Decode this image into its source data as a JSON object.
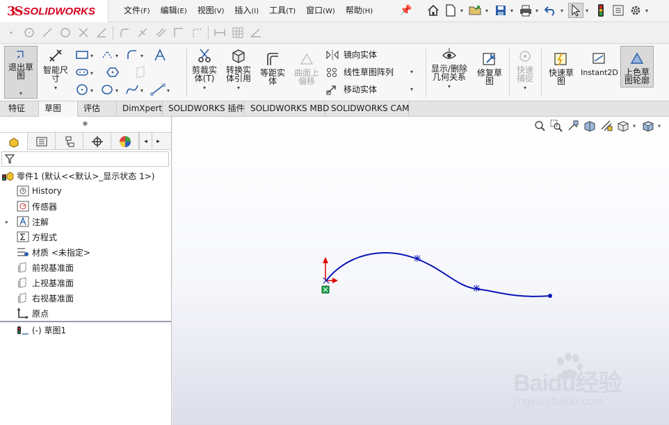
{
  "app": {
    "logo_mark": "3S",
    "logo_text": "SOLIDWORKS"
  },
  "menu": [
    {
      "label": "文件",
      "key": "(F)"
    },
    {
      "label": "编辑",
      "key": "(E)"
    },
    {
      "label": "视图",
      "key": "(V)"
    },
    {
      "label": "插入",
      "key": "(I)"
    },
    {
      "label": "工具",
      "key": "(T)"
    },
    {
      "label": "窗口",
      "key": "(W)"
    },
    {
      "label": "帮助",
      "key": "(H)"
    }
  ],
  "ribbon": {
    "exit_sketch": "退出草图",
    "smart_dimension": "智能尺寸",
    "trim": "剪裁实体(T)",
    "convert": "转换实体引用",
    "offset": "等距实体",
    "surface_offset": "曲面上偏移",
    "mirror": "镜向实体",
    "linear_pattern": "线性草图阵列",
    "move": "移动实体",
    "display_delete": "显示/删除几何关系",
    "repair": "修复草图",
    "quick_snap": "快速捕捉",
    "rapid_sketch": "快速草图",
    "instant2d": "Instant2D",
    "shaded_contour": "上色草图轮廓"
  },
  "tabs": [
    "特征",
    "草图",
    "评估",
    "DimXpert",
    "SOLIDWORKS 插件",
    "SOLIDWORKS MBD",
    "SOLIDWORKS CAM"
  ],
  "active_tab": "草图",
  "tree": {
    "root": "零件1 (默认<<默认>_显示状态 1>)",
    "items": [
      "History",
      "传感器",
      "注解",
      "方程式",
      "材质 <未指定>",
      "前视基准面",
      "上视基准面",
      "右视基准面",
      "原点",
      "(-) 草图1"
    ]
  },
  "watermark": {
    "main": "Baidu经验",
    "sub": "jingyan.baidu.com"
  },
  "colors": {
    "accent": "#d6001c",
    "curve": "#0a14b4",
    "origin_red": "#e00000",
    "origin_green": "#1aa84a"
  }
}
